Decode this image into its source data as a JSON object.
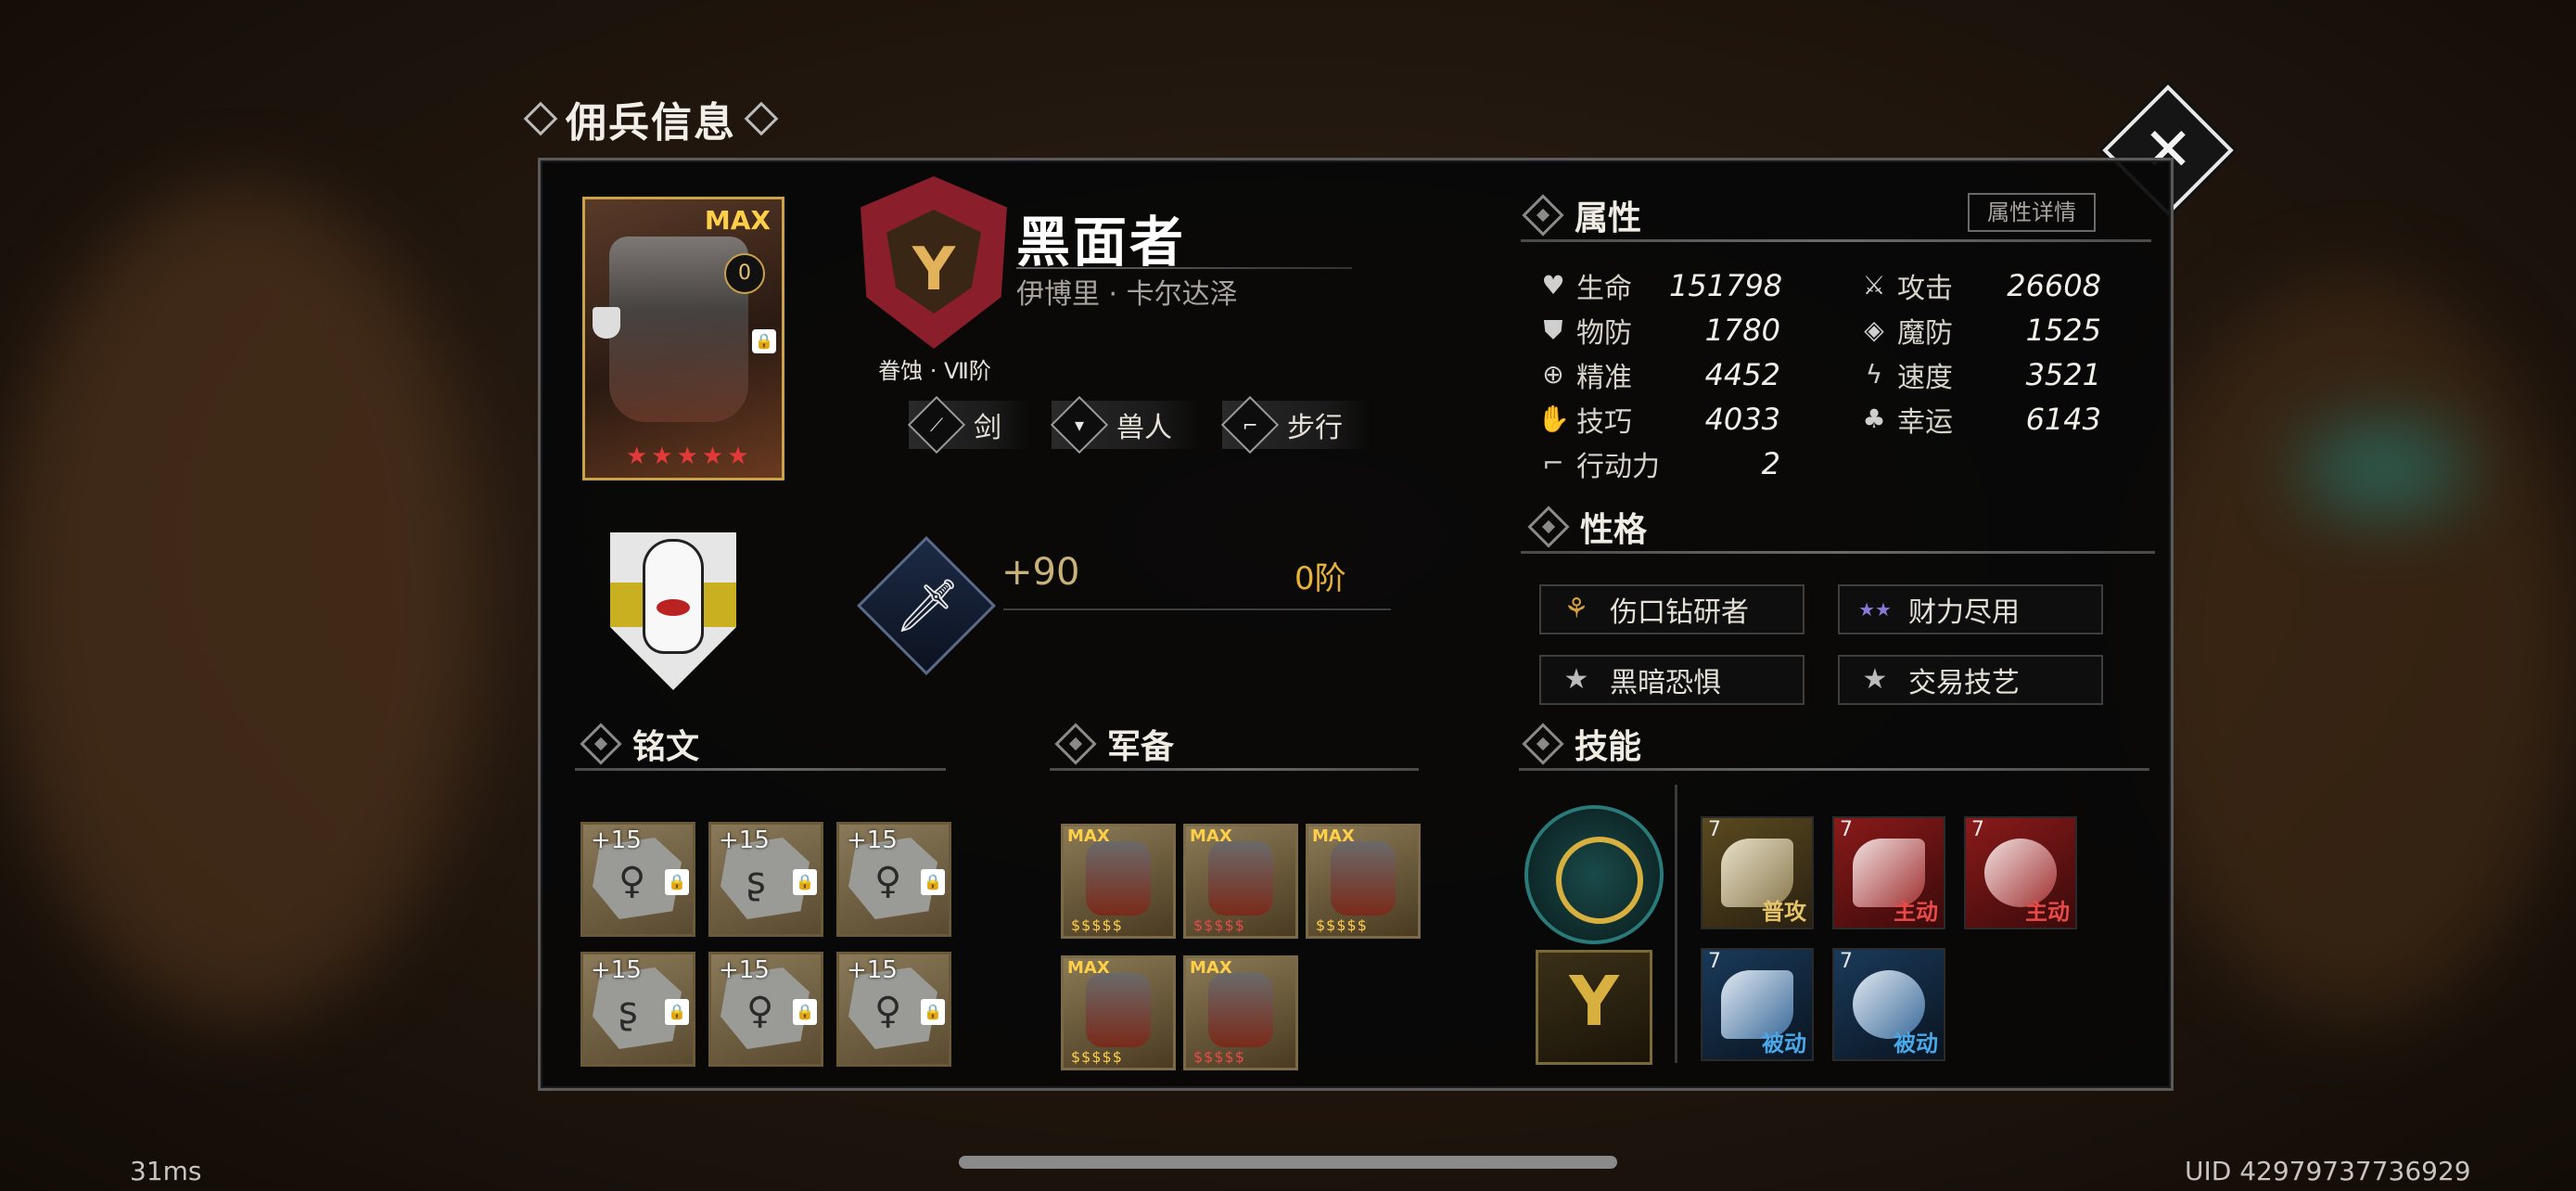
{
  "window": {
    "title": "佣兵信息",
    "close_label": "✕"
  },
  "character": {
    "name": "黑面者",
    "subtitle": "伊博里 · 卡尔达泽",
    "card_max": "MAX",
    "card_level": "0",
    "crest_label": "眷蚀 · Ⅶ阶",
    "tags": [
      {
        "label": "剑",
        "icon": "sword-icon"
      },
      {
        "label": "兽人",
        "icon": "fang-icon"
      },
      {
        "label": "步行",
        "icon": "boot-icon"
      }
    ]
  },
  "weapon": {
    "enhance": "+90",
    "tier": "0阶",
    "icon": "sword-icon"
  },
  "attributes": {
    "title": "属性",
    "detail_button": "属性详情",
    "stats": [
      {
        "label": "生命",
        "value": "151798",
        "icon": "heart-icon"
      },
      {
        "label": "攻击",
        "value": "26608",
        "icon": "crossed-swords-icon"
      },
      {
        "label": "物防",
        "value": "1780",
        "icon": "shield-icon"
      },
      {
        "label": "魔防",
        "value": "1525",
        "icon": "magic-shield-icon"
      },
      {
        "label": "精准",
        "value": "4452",
        "icon": "crosshair-icon"
      },
      {
        "label": "速度",
        "value": "3521",
        "icon": "speed-icon"
      },
      {
        "label": "技巧",
        "value": "4033",
        "icon": "skill-icon"
      },
      {
        "label": "幸运",
        "value": "6143",
        "icon": "clover-icon"
      },
      {
        "label": "行动力",
        "value": "2",
        "icon": "boot-icon"
      }
    ]
  },
  "personality": {
    "title": "性格",
    "traits": [
      {
        "label": "伤口钻研者",
        "icon": "triquetra-icon"
      },
      {
        "label": "财力尽用",
        "icon": "four-stars-icon"
      },
      {
        "label": "黑暗恐惧",
        "icon": "star-icon"
      },
      {
        "label": "交易技艺",
        "icon": "star-icon"
      }
    ]
  },
  "inscriptions": {
    "title": "铭文",
    "slots": [
      {
        "plus": "+15",
        "rune": "♀"
      },
      {
        "plus": "+15",
        "rune": "ʂ"
      },
      {
        "plus": "+15",
        "rune": "♀"
      },
      {
        "plus": "+15",
        "rune": "ʂ"
      },
      {
        "plus": "+15",
        "rune": "♀"
      },
      {
        "plus": "+15",
        "rune": "♀"
      }
    ]
  },
  "equipment": {
    "title": "军备",
    "items": [
      {
        "max": "MAX",
        "name": "armor-helmet"
      },
      {
        "max": "MAX",
        "name": "armor-shoulder"
      },
      {
        "max": "MAX",
        "name": "armor-chest"
      },
      {
        "max": "MAX",
        "name": "armor-legs"
      },
      {
        "max": "MAX",
        "name": "armor-gauntlet"
      }
    ]
  },
  "skills": {
    "title": "技能",
    "list": [
      {
        "level": "7",
        "kind": "普攻",
        "color": "#e6c46a"
      },
      {
        "level": "7",
        "kind": "主动",
        "color": "#e84a4a"
      },
      {
        "level": "7",
        "kind": "主动",
        "color": "#e84a4a"
      },
      {
        "level": "7",
        "kind": "被动",
        "color": "#4aa8e8"
      },
      {
        "level": "7",
        "kind": "被动",
        "color": "#4aa8e8"
      }
    ]
  },
  "footer": {
    "latency": "31ms",
    "uid": "UID 42979737736929"
  },
  "colors": {
    "gold": "#e6b23a",
    "crest_red": "#8a1e2a",
    "active_red": "#e84a4a",
    "passive_blue": "#4aa8e8"
  }
}
